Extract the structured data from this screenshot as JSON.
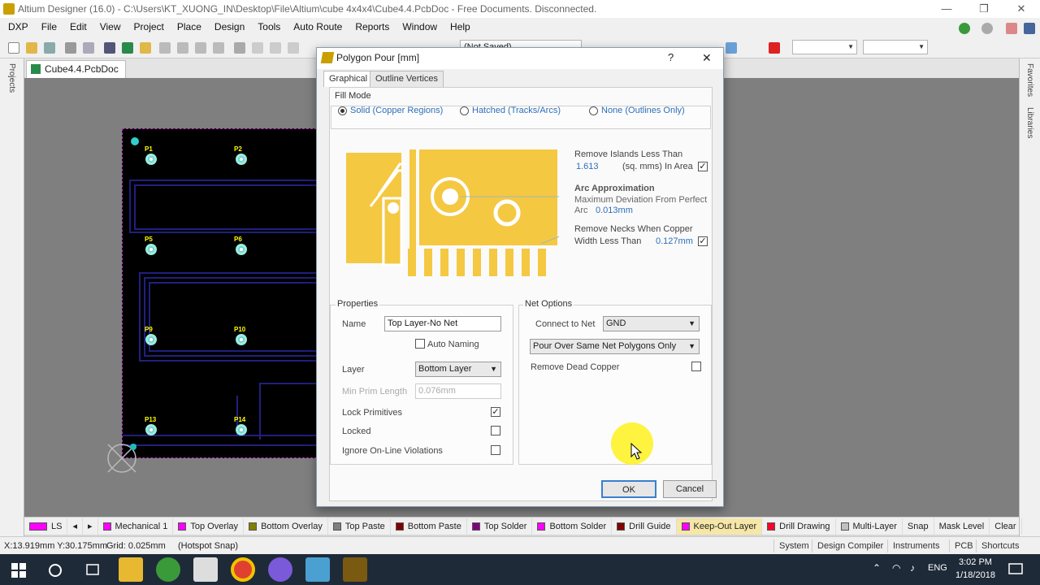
{
  "window": {
    "title": "Altium Designer (16.0) - C:\\Users\\KT_XUONG_IN\\Desktop\\File\\Altium\\cube 4x4x4\\Cube4.4.PcbDoc - Free Documents. Disconnected.",
    "minimize": "—",
    "maximize": "❐",
    "close": "✕"
  },
  "menu": [
    "DXP",
    "File",
    "Edit",
    "View",
    "Project",
    "Place",
    "Design",
    "Tools",
    "Auto Route",
    "Reports",
    "Window",
    "Help"
  ],
  "toolbar": {
    "not_saved": "(Not Saved)"
  },
  "side_panels": {
    "left": "Projects",
    "right_top": "Favorites",
    "right_bottom": "Libraries"
  },
  "document_tab": "Cube4.4.PcbDoc",
  "pads": [
    "P1",
    "P2",
    "P5",
    "P6",
    "P9",
    "P10",
    "P13",
    "P14"
  ],
  "dialog": {
    "title": "Polygon Pour [mm]",
    "help": "?",
    "close": "✕",
    "tabs": [
      "Graphical",
      "Outline Vertices"
    ],
    "fill_mode": {
      "title": "Fill Mode",
      "options": [
        "Solid (Copper Regions)",
        "Hatched (Tracks/Arcs)",
        "None (Outlines Only)"
      ],
      "selected": 0
    },
    "islands": {
      "label": "Remove Islands Less Than",
      "value": "1.613",
      "unit": "(sq. mms) In Area",
      "checked": true
    },
    "arc": {
      "title": "Arc Approximation",
      "line1": "Maximum Deviation From Perfect",
      "line2_label": "Arc",
      "value": "0.013mm"
    },
    "necks": {
      "line1": "Remove Necks When Copper",
      "line2": "Width Less Than",
      "value": "0.127mm",
      "checked": true
    },
    "properties": {
      "title": "Properties",
      "name_label": "Name",
      "name_value": "Top Layer-No Net",
      "auto_naming": "Auto Naming",
      "layer_label": "Layer",
      "layer_value": "Bottom Layer",
      "min_prim_label": "Min Prim Length",
      "min_prim_value": "0.076mm",
      "lock_primitives": "Lock Primitives",
      "locked": "Locked",
      "ignore": "Ignore On-Line Violations"
    },
    "net_options": {
      "title": "Net Options",
      "connect_label": "Connect to Net",
      "connect_value": "GND",
      "pour_value": "Pour Over Same Net Polygons Only",
      "dead_copper": "Remove Dead Copper"
    },
    "ok": "OK",
    "cancel": "Cancel"
  },
  "layers": [
    {
      "name": "LS",
      "color": "#ff00ff"
    },
    {
      "name": "Mechanical 1",
      "color": "#ff00ff"
    },
    {
      "name": "Top Overlay",
      "color": "#ff00ff"
    },
    {
      "name": "Bottom Overlay",
      "color": "#808000"
    },
    {
      "name": "Top Paste",
      "color": "#808080"
    },
    {
      "name": "Bottom Paste",
      "color": "#800000"
    },
    {
      "name": "Top Solder",
      "color": "#800080"
    },
    {
      "name": "Bottom Solder",
      "color": "#ff00ff"
    },
    {
      "name": "Drill Guide",
      "color": "#800000"
    },
    {
      "name": "Keep-Out Layer",
      "color": "#ff00ff"
    },
    {
      "name": "Drill Drawing",
      "color": "#ff002a"
    },
    {
      "name": "Multi-Layer",
      "color": "#c0c0c0"
    }
  ],
  "layer_right": [
    "Snap",
    "Mask Level",
    "Clear"
  ],
  "status": {
    "coords": "X:13.919mm Y:30.175mm",
    "grid": "Grid: 0.025mm",
    "snap": "(Hotspot Snap)",
    "buttons": [
      "System",
      "Design Compiler",
      "Instruments",
      "PCB",
      "Shortcuts"
    ]
  },
  "tray": {
    "lang": "ENG",
    "time": "3:02 PM",
    "date": "1/18/2018"
  }
}
